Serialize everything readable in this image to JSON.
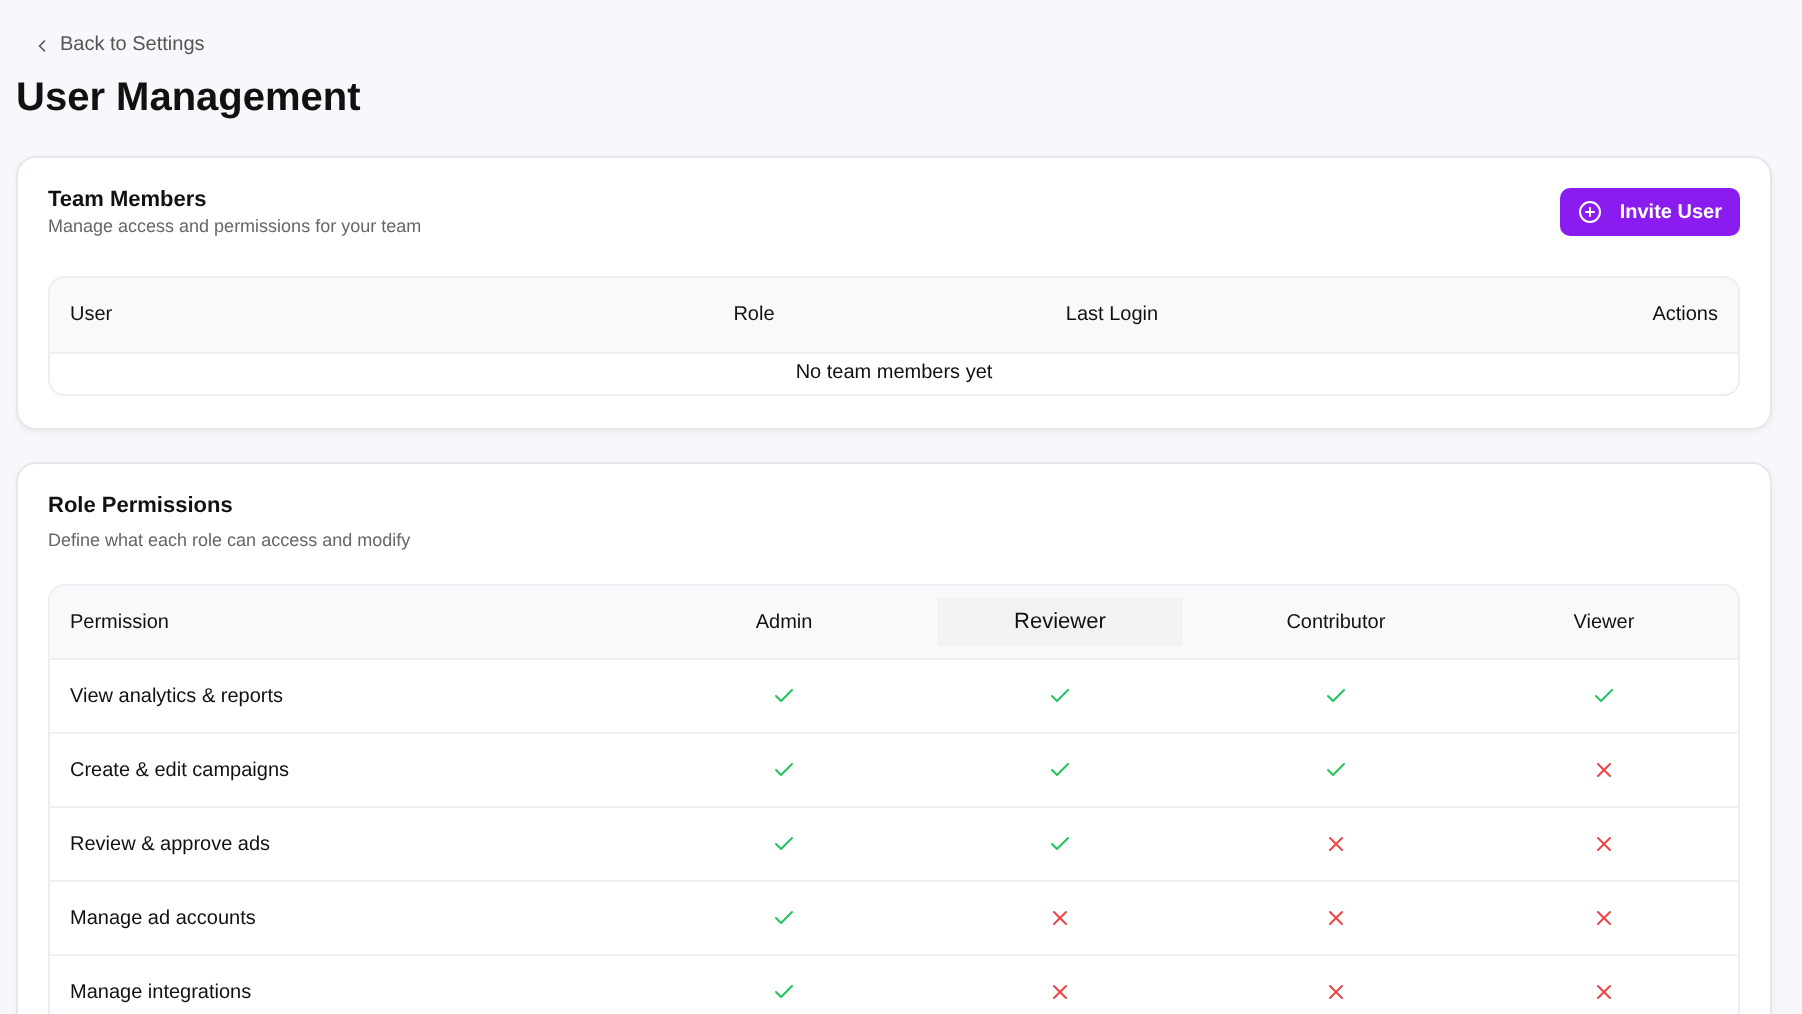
{
  "back_link": "Back to Settings",
  "title": "User Management",
  "team_members": {
    "title": "Team Members",
    "subtitle": "Manage access and permissions for your team",
    "invite_button": "Invite User",
    "columns": [
      "User",
      "Role",
      "Last Login",
      "Actions"
    ],
    "empty_message": "No team members yet"
  },
  "role_permissions": {
    "title": "Role Permissions",
    "subtitle": "Define what each role can access and modify",
    "first_column": "Permission",
    "roles": [
      {
        "label": "Admin",
        "highlighted": false
      },
      {
        "label": "Reviewer",
        "highlighted": true
      },
      {
        "label": "Contributor",
        "highlighted": false
      },
      {
        "label": "Viewer",
        "highlighted": false
      }
    ],
    "rows": [
      {
        "label": "View analytics & reports",
        "allowed": [
          true,
          true,
          true,
          true
        ]
      },
      {
        "label": "Create & edit campaigns",
        "allowed": [
          true,
          true,
          true,
          false
        ]
      },
      {
        "label": "Review & approve ads",
        "allowed": [
          true,
          true,
          false,
          false
        ]
      },
      {
        "label": "Manage ad accounts",
        "allowed": [
          true,
          false,
          false,
          false
        ]
      },
      {
        "label": "Manage integrations",
        "allowed": [
          true,
          false,
          false,
          false
        ]
      }
    ]
  }
}
